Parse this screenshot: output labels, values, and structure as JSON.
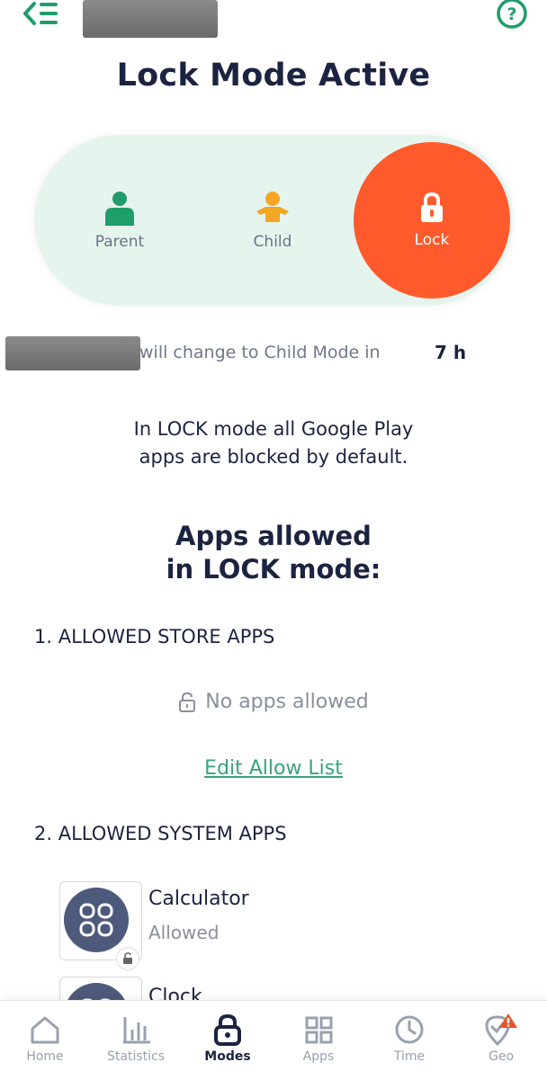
{
  "header": {
    "back_icon": "back-menu-icon",
    "help_icon": "help-icon",
    "accent": "#1f9d6b"
  },
  "title": "Lock Mode Active",
  "modes": [
    {
      "label": "Parent",
      "icon": "parent-person-icon",
      "color": "#1f9d6b"
    },
    {
      "label": "Child",
      "icon": "child-person-icon",
      "color": "#f5a623"
    },
    {
      "label": "Lock",
      "icon": "lock-icon",
      "color": "#ff5a2c",
      "selected": true
    }
  ],
  "mode_change": {
    "text": "will change to Child Mode in",
    "time": "7 h"
  },
  "info_text": [
    "In LOCK mode all Google Play",
    "apps are blocked by default."
  ],
  "allowed_heading": [
    "Apps allowed",
    "in LOCK mode:"
  ],
  "store_section": {
    "title": "1.  ALLOWED STORE APPS",
    "empty_text": "No apps allowed",
    "edit_link": "Edit Allow List"
  },
  "system_section": {
    "title": "2.  ALLOWED SYSTEM APPS",
    "apps": [
      {
        "name": "Calculator",
        "status": "Allowed"
      },
      {
        "name": "Clock",
        "status": ""
      }
    ]
  },
  "nav": [
    {
      "label": "Home",
      "icon": "home-icon"
    },
    {
      "label": "Statistics",
      "icon": "statistics-icon"
    },
    {
      "label": "Modes",
      "icon": "lock-icon",
      "active": true
    },
    {
      "label": "Apps",
      "icon": "apps-grid-icon"
    },
    {
      "label": "Time",
      "icon": "clock-icon"
    },
    {
      "label": "Geo",
      "icon": "geo-pin-icon"
    }
  ]
}
